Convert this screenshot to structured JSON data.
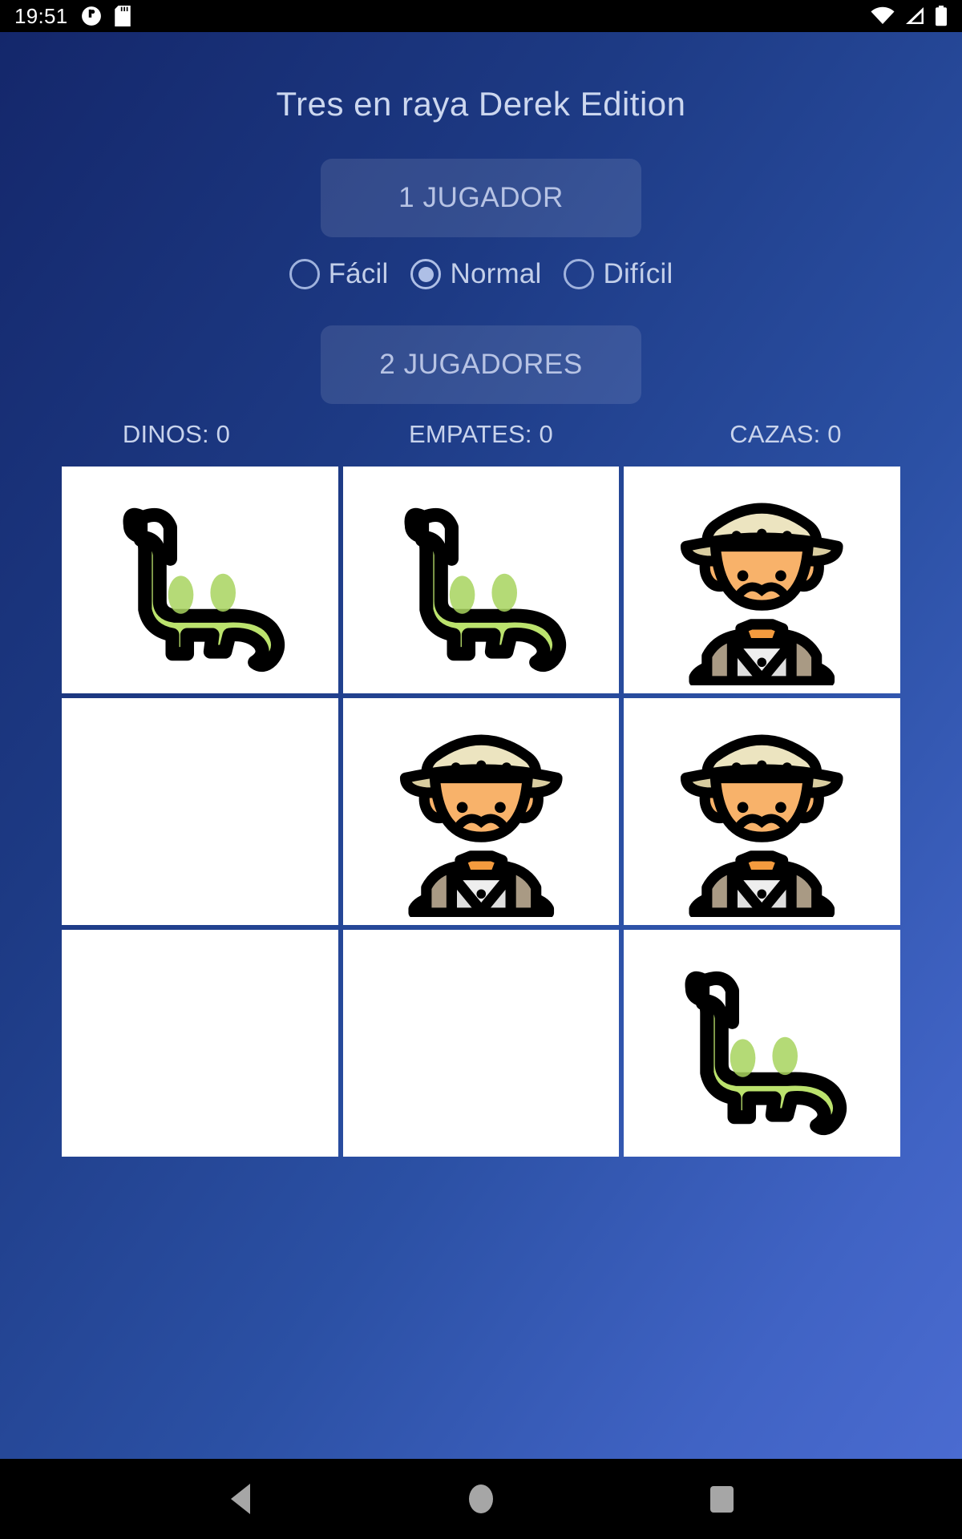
{
  "status_bar": {
    "time": "19:51",
    "left_icons": [
      "clock-badge-icon",
      "sd-card-icon"
    ],
    "right_icons": [
      "wifi-icon",
      "cellular-signal-icon",
      "battery-icon"
    ]
  },
  "app": {
    "title": "Tres en raya Derek Edition",
    "one_player_button": "1 JUGADOR",
    "two_players_button": "2 JUGADORES",
    "difficulty": {
      "options": [
        {
          "label": "Fácil",
          "selected": false
        },
        {
          "label": "Normal",
          "selected": true
        },
        {
          "label": "Difícil",
          "selected": false
        }
      ]
    },
    "scores": [
      {
        "label": "DINOS: 0"
      },
      {
        "label": "EMPATES: 0"
      },
      {
        "label": "CAZAS: 0"
      }
    ],
    "board": {
      "cells": [
        {
          "index": 0,
          "mark": "dino"
        },
        {
          "index": 1,
          "mark": "dino"
        },
        {
          "index": 2,
          "mark": "hunter"
        },
        {
          "index": 3,
          "mark": ""
        },
        {
          "index": 4,
          "mark": "hunter"
        },
        {
          "index": 5,
          "mark": "hunter"
        },
        {
          "index": 6,
          "mark": ""
        },
        {
          "index": 7,
          "mark": ""
        },
        {
          "index": 8,
          "mark": "dino"
        }
      ]
    },
    "colors": {
      "background_dark": "#14276b",
      "background_light": "#4a6bd0",
      "cell_background": "#ffffff",
      "text": "#c8d3ec",
      "dino_body": "#b7e06a",
      "dino_outline": "#000000",
      "hunter_hat": "#ece4c0",
      "hunter_skin": "#f8b26a",
      "hunter_vest": "#a99a84"
    }
  },
  "nav_bar": {
    "buttons": [
      {
        "name": "back",
        "icon": "triangle-left-icon"
      },
      {
        "name": "home",
        "icon": "circle-icon"
      },
      {
        "name": "recents",
        "icon": "square-icon"
      }
    ]
  }
}
